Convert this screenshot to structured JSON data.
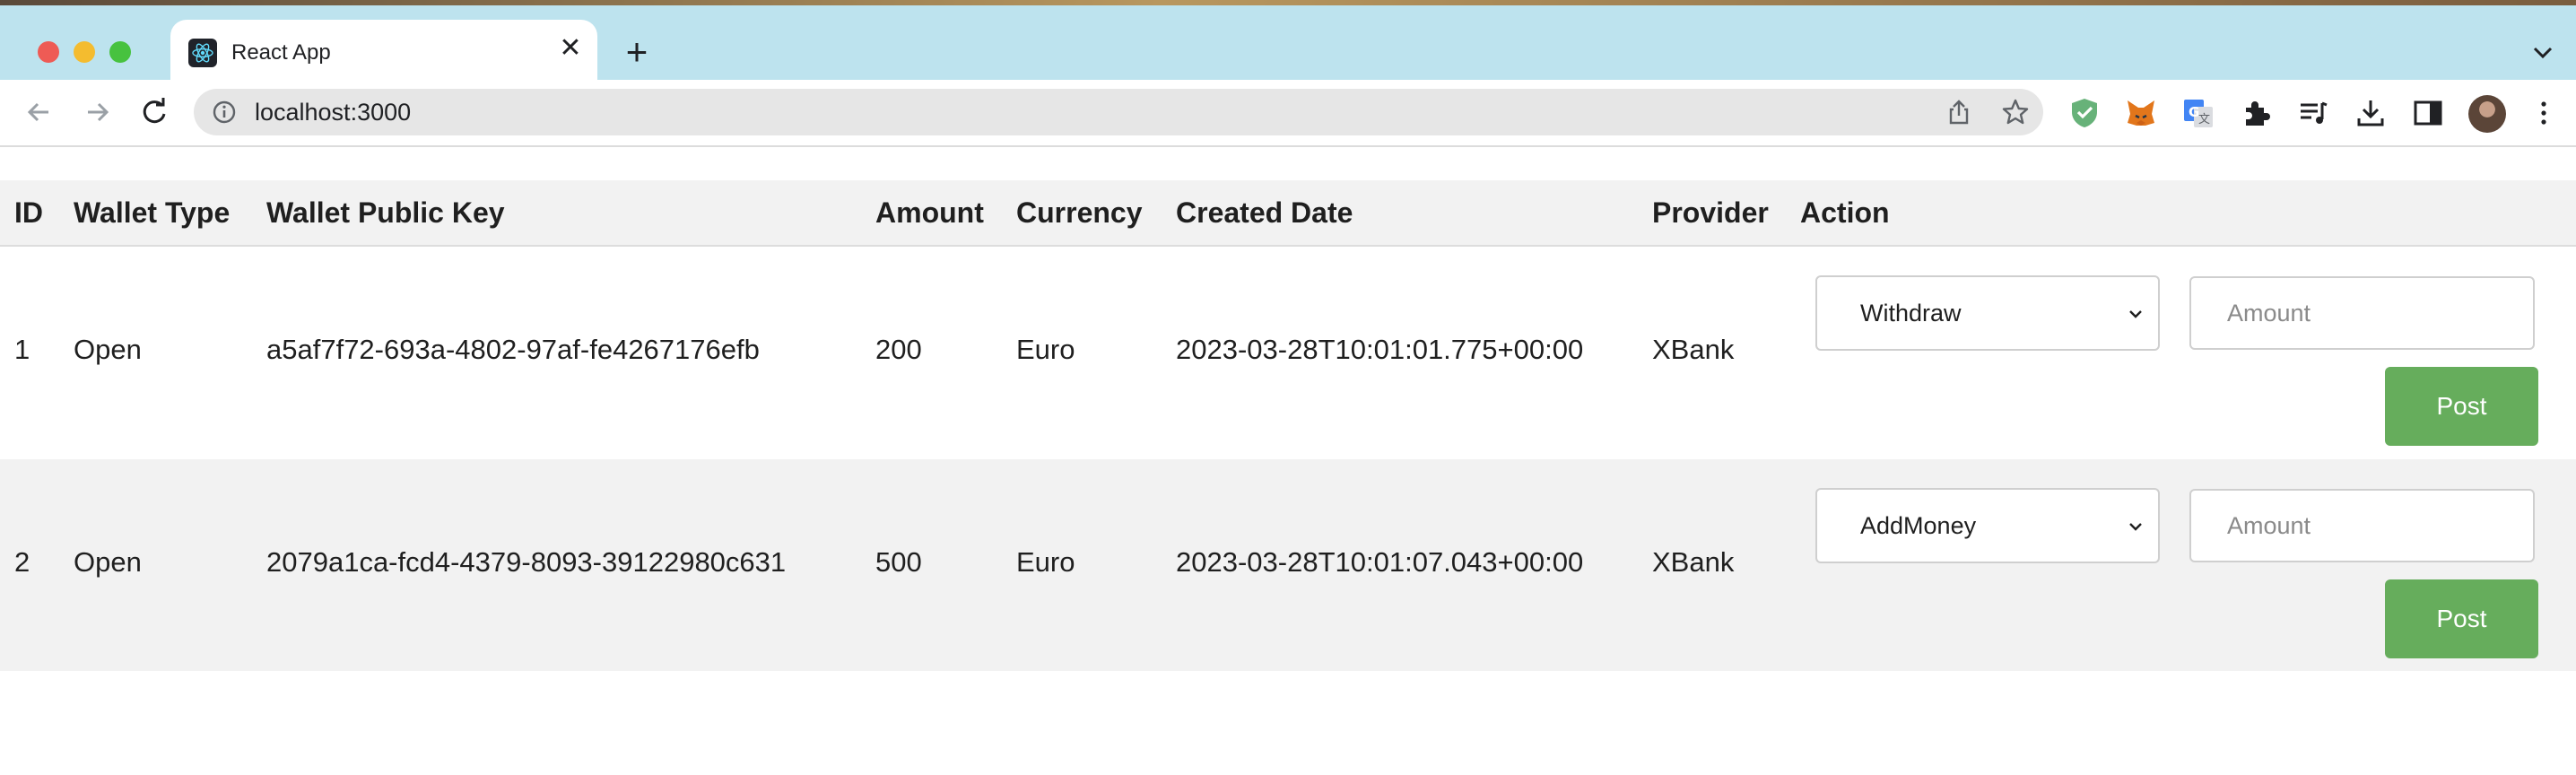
{
  "browser": {
    "tab_title": "React App",
    "tab_close": "✕",
    "new_tab": "+",
    "url": "localhost:3000",
    "colors": {
      "tab_bar": "#bde3ee",
      "omnibox": "#e6e6e6"
    },
    "extensions": [
      "adguard-shield-icon",
      "metamask-fox-icon",
      "google-translate-icon",
      "extensions-puzzle-icon",
      "media-queue-icon",
      "downloads-icon",
      "side-panel-icon"
    ]
  },
  "table": {
    "headers": {
      "id": "ID",
      "wallet_type": "Wallet Type",
      "public_key": "Wallet Public Key",
      "amount": "Amount",
      "currency": "Currency",
      "created_date": "Created Date",
      "provider": "Provider",
      "action": "Action"
    },
    "rows": [
      {
        "id": "1",
        "wallet_type": "Open",
        "public_key": "a5af7f72-693a-4802-97af-fe4267176efb",
        "amount": "200",
        "currency": "Euro",
        "created_date": "2023-03-28T10:01:01.775+00:00",
        "provider": "XBank",
        "action_selected": "Withdraw",
        "amount_placeholder": "Amount",
        "post_label": "Post"
      },
      {
        "id": "2",
        "wallet_type": "Open",
        "public_key": "2079a1ca-fcd4-4379-8093-39122980c631",
        "amount": "500",
        "currency": "Euro",
        "created_date": "2023-03-28T10:01:07.043+00:00",
        "provider": "XBank",
        "action_selected": "AddMoney",
        "amount_placeholder": "Amount",
        "post_label": "Post"
      }
    ],
    "colors": {
      "header_bg": "#f2f2f2",
      "alt_row_bg": "#f2f2f2",
      "post_button": "#66ad5c"
    }
  }
}
